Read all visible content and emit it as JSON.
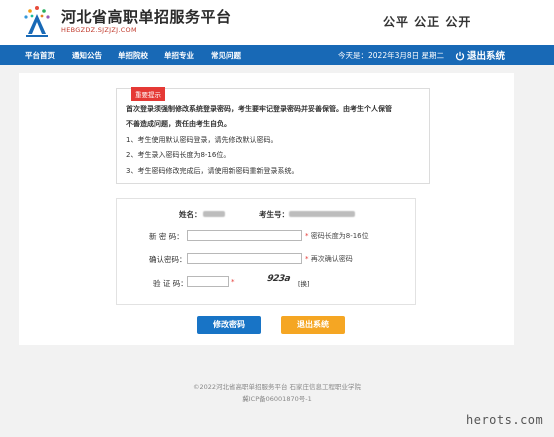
{
  "header": {
    "site_title": "河北省高职单招服务平台",
    "site_domain": "HEBGZDZ.SJZJZJ.COM",
    "slogan": "公平  公正  公开"
  },
  "nav": {
    "items": [
      "平台首页",
      "通知公告",
      "单招院校",
      "单招专业",
      "常见问题"
    ],
    "date_text": "今天是：2022年3月8日 星期二",
    "logout_label": "退出系统"
  },
  "notice": {
    "tag": "重要提示",
    "line1": "首次登录须强制修改系统登录密码，考生要牢记登录密码并妥善保管。由考生个人保管",
    "line2": "不善造成问题，责任由考生自负。",
    "line3": "1、考生使用默认密码登录，请先修改默认密码。",
    "line4": "2、考生录入密码长度为8-16位。",
    "line5": "3、考生密码修改完成后，请使用新密码重新登录系统。"
  },
  "form": {
    "name_label": "姓名：",
    "exam_no_label": "考生号：",
    "new_pwd_label": "新 密 码：",
    "new_pwd_hint": "密码长度为8-16位",
    "confirm_pwd_label": "确认密码：",
    "confirm_pwd_hint": "再次确认密码",
    "captcha_label": "验 证 码：",
    "captcha_text": "923a",
    "captcha_refresh": "[换]"
  },
  "buttons": {
    "change_pwd": "修改密码",
    "logout": "退出系统"
  },
  "footer": {
    "line1": "©2022河北省高职单招服务平台  石家庄信息工程职业学院",
    "line2": "冀ICP备06001870号-1"
  },
  "watermark": "herots.com",
  "colors": {
    "nav_bg": "#1869b6",
    "primary_button": "#1874c6",
    "secondary_button": "#f5a623",
    "tag": "#e53935"
  }
}
